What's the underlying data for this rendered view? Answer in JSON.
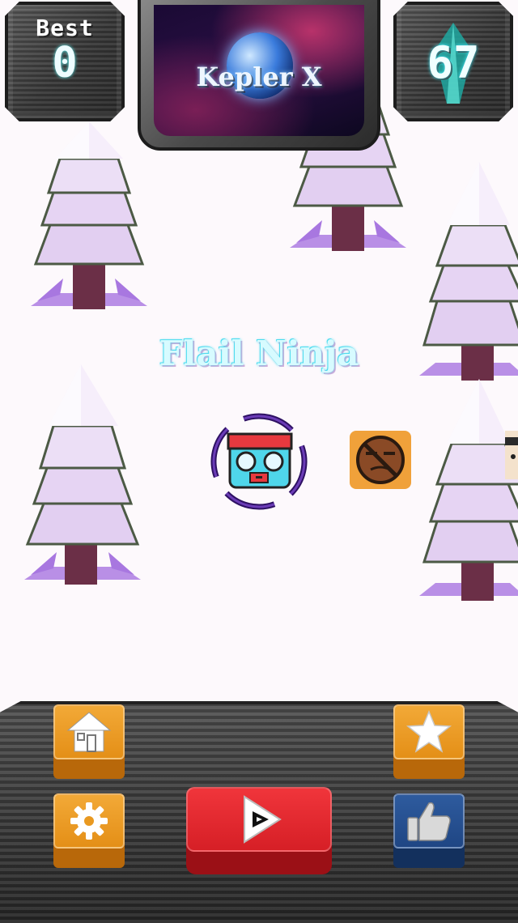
{
  "hud": {
    "best_label": "Best",
    "best_value": "0",
    "gems_value": "67"
  },
  "banner": {
    "title": "Kepler X"
  },
  "game": {
    "title": "Flail Ninja"
  },
  "icons": {
    "gem": "gem-icon",
    "home": "home-icon",
    "star": "star-icon",
    "settings": "gear-icon",
    "like": "thumbs-up-icon",
    "play": "play-icon"
  },
  "colors": {
    "play": "#e0262d",
    "menu_button": "#eb9c23",
    "like_button": "#2a5596",
    "title_glow": "#3fd6ec",
    "tree_snow": "#e9d8f3",
    "tree_trunk": "#6b2f47"
  }
}
